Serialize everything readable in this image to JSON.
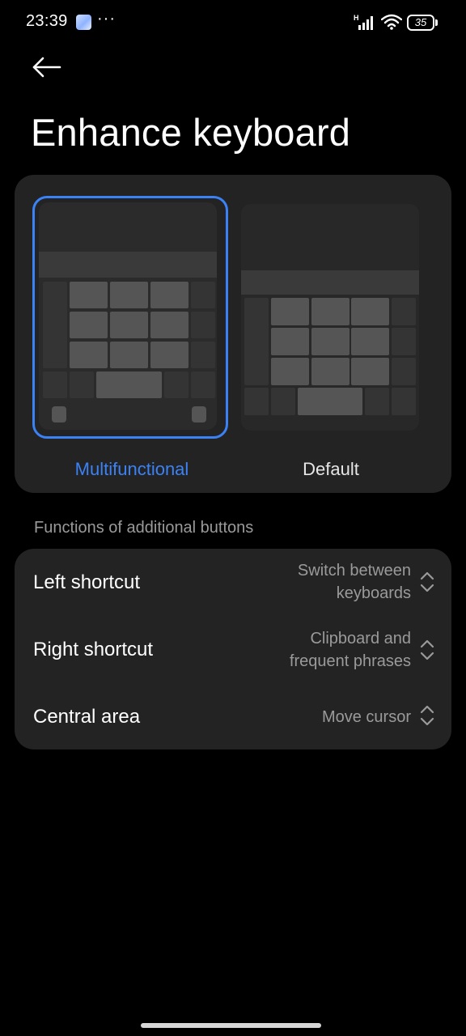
{
  "status_bar": {
    "time": "23:39",
    "more_indicator": "···",
    "network_type": "H",
    "battery_level": "35",
    "icons": [
      "notification-app-icon",
      "signal-icon",
      "wifi-icon",
      "battery-icon"
    ]
  },
  "header": {
    "back_icon": "back-arrow-icon",
    "title": "Enhance keyboard"
  },
  "keyboard_styles": {
    "options": [
      {
        "label": "Multifunctional",
        "selected": true
      },
      {
        "label": "Default",
        "selected": false
      }
    ],
    "accent_color": "#3b82f6"
  },
  "additional_buttons": {
    "section_title": "Functions of additional buttons",
    "rows": [
      {
        "label": "Left shortcut",
        "value": "Switch between keyboards",
        "icon": "up-down-chevron-icon"
      },
      {
        "label": "Right shortcut",
        "value": "Clipboard and frequent phrases",
        "icon": "up-down-chevron-icon"
      },
      {
        "label": "Central area",
        "value": "Move cursor",
        "icon": "up-down-chevron-icon"
      }
    ]
  },
  "colors": {
    "background": "#000000",
    "card": "#232323",
    "secondary_text": "#9a9a9a"
  }
}
